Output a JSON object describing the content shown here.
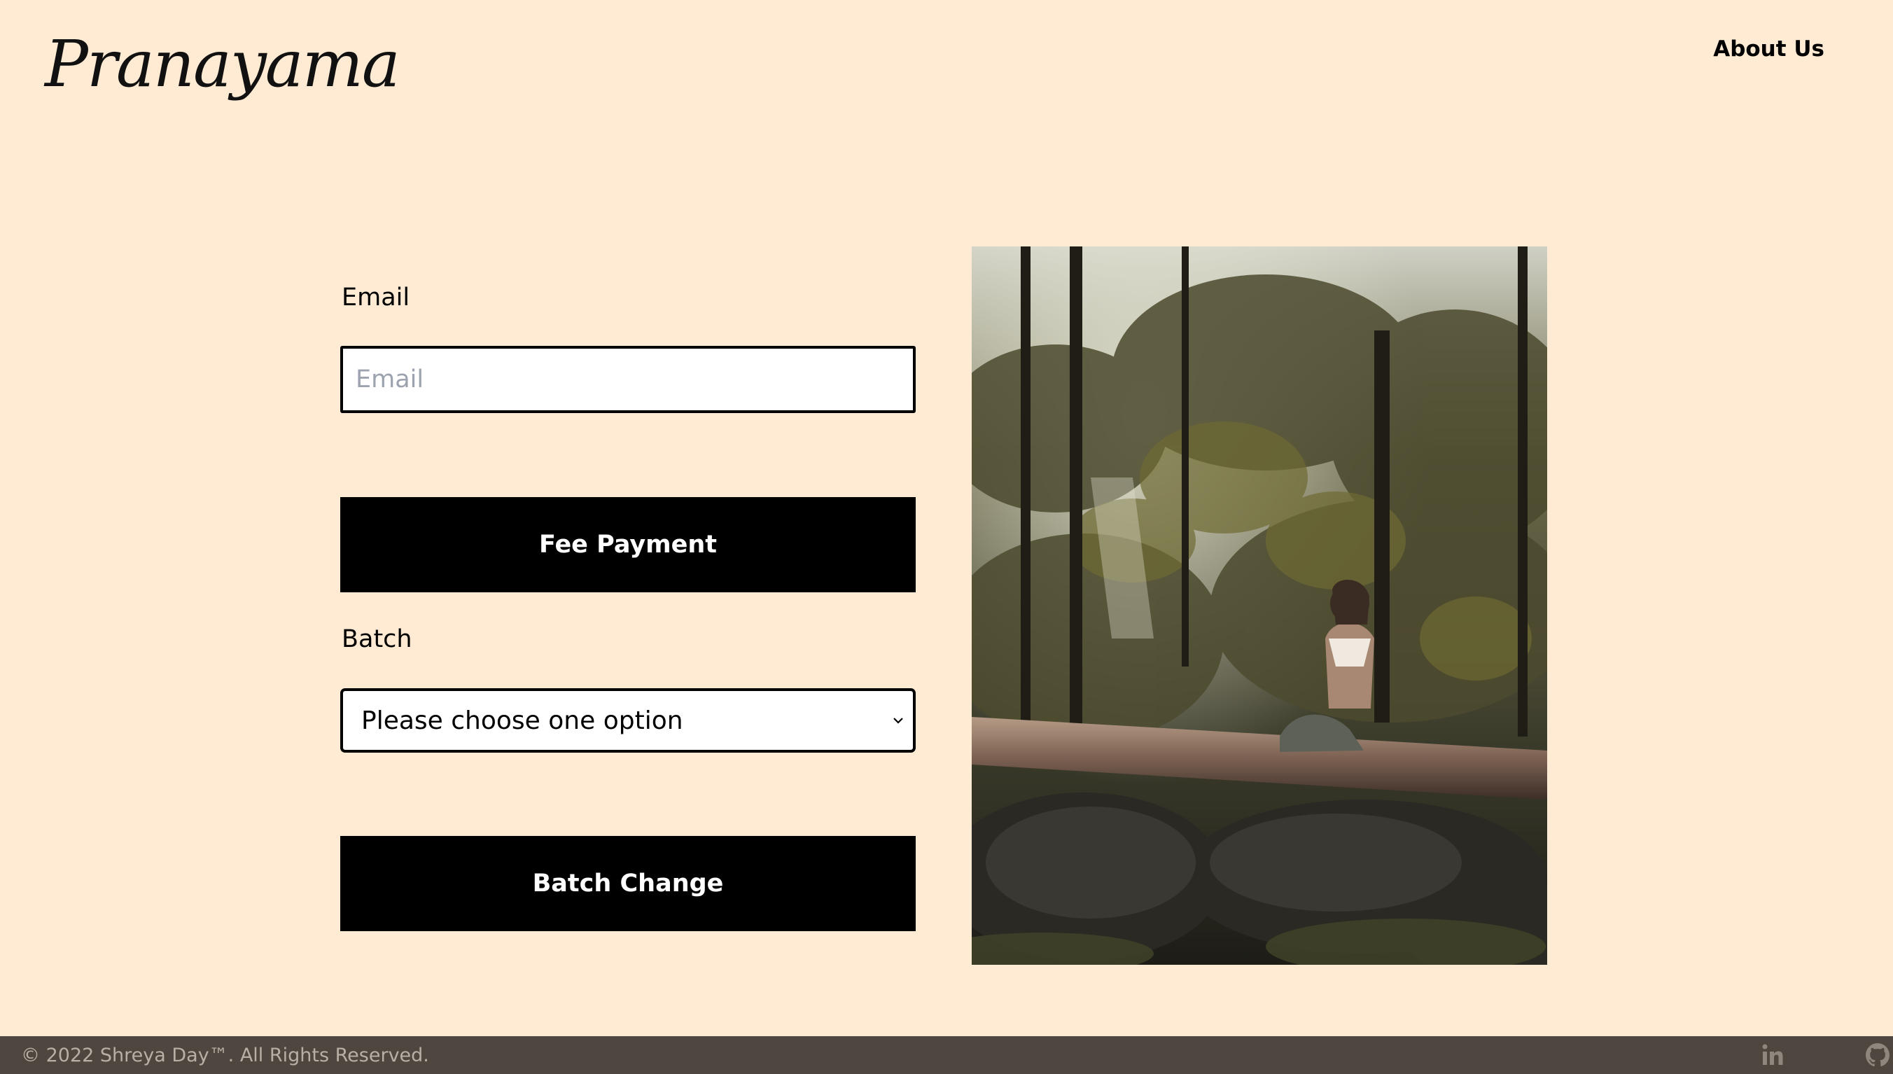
{
  "header": {
    "logo_text": "Pranayama",
    "nav_about": "About Us"
  },
  "form": {
    "email_label": "Email",
    "email_placeholder": "Email",
    "email_value": "",
    "fee_button": "Fee Payment",
    "batch_label": "Batch",
    "batch_selected": "Please choose one option",
    "batch_change_button": "Batch Change"
  },
  "footer": {
    "copyright": "© 2022 Shreya Day™. All Rights Reserved.",
    "icons": [
      "linkedin-icon",
      "github-icon"
    ]
  },
  "colors": {
    "background": "#ffebd3",
    "button": "#000000",
    "footer": "#4d4740",
    "footer_text": "#b8b0a6"
  }
}
